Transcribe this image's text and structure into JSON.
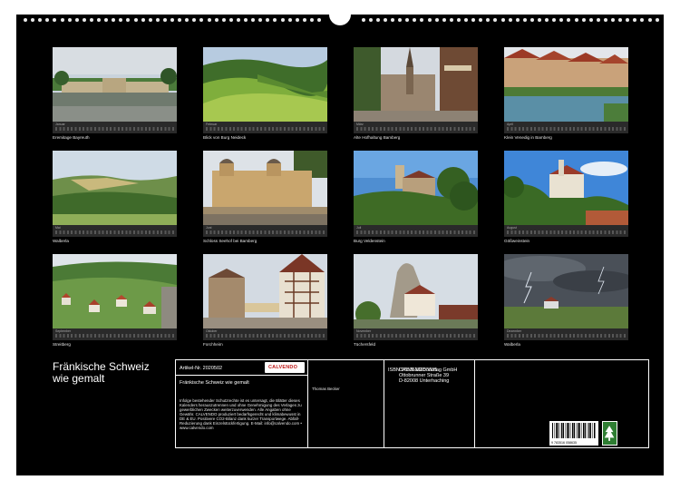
{
  "calendar": {
    "title_line1": "Fränkische Schweiz",
    "title_line2": "wie gemalt"
  },
  "months": [
    {
      "month": "Januar",
      "caption": "Eremitage Bayreuth",
      "icon": "palace-garden-photo"
    },
    {
      "month": "Februar",
      "caption": "Blick von Burg Neideck",
      "icon": "green-hills-photo"
    },
    {
      "month": "März",
      "caption": "Alte Hofhaltung Bamberg",
      "icon": "old-town-courtyard-photo"
    },
    {
      "month": "April",
      "caption": "Klein Venedig in Bamberg",
      "icon": "riverside-houses-photo"
    },
    {
      "month": "Mai",
      "caption": "Walberla",
      "icon": "plateau-landscape-photo"
    },
    {
      "month": "Juni",
      "caption": "Schloss Seehof bei Bamberg",
      "icon": "baroque-palace-photo"
    },
    {
      "month": "Juli",
      "caption": "Burg Veldenstein",
      "icon": "hill-castle-photo"
    },
    {
      "month": "August",
      "caption": "Gößweinstein",
      "icon": "castle-on-rock-photo"
    },
    {
      "month": "September",
      "caption": "Streitberg",
      "icon": "valley-village-photo"
    },
    {
      "month": "Oktober",
      "caption": "Forchheim",
      "icon": "half-timbered-town-hall-photo"
    },
    {
      "month": "November",
      "caption": "Tüchersfeld",
      "icon": "rock-village-photo"
    },
    {
      "month": "Dezember",
      "caption": "Walberla",
      "icon": "storm-clouds-photo"
    }
  ],
  "imprint": {
    "article_nr": "Artikel-Nr. 2020502",
    "title": "Fränkische Schweiz wie gemalt",
    "rights_text": "Infolge bestehender Schutzrechte ist es untersagt, die Blätter dieses Kalenders herauszutrennen und ohne Genehmigung des Verlages zu gewerblichen Zwecken weiterzuverwenden. Alle Angaben ohne Gewähr. CALVENDO produziert bedarfsgerecht und klimabewusst in DE & EU. Positivere CO2-Bilanz dank kurzer Transportwege. Abfall-Reduzierung dank Einzelstückfertigung. E-Mail: info@calvendo.com • www.calvendo.com",
    "author": "Thomas Becker",
    "isbn": "ISBN 9783516058635",
    "publisher_line1": "CALVENDO Verlag GmbH",
    "publisher_line2": "Ottobrunner Straße 39",
    "publisher_line3": "D-82008 Unterhaching",
    "logo_text": "CALVENDO",
    "barcode_digits": "9 783516 058635"
  },
  "colors": {
    "background": "#000000",
    "logo": "#c01a1a",
    "fsc": "#2e7d32"
  }
}
